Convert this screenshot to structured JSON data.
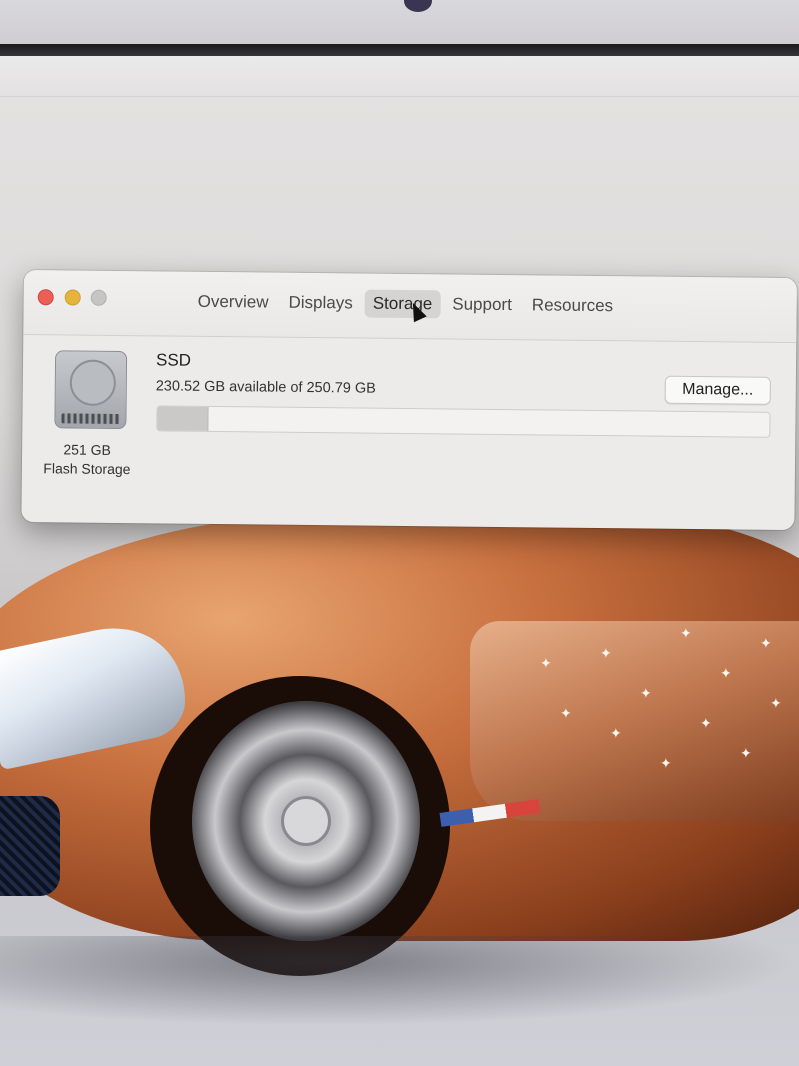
{
  "window": {
    "tabs": [
      {
        "label": "Overview",
        "active": false
      },
      {
        "label": "Displays",
        "active": false
      },
      {
        "label": "Storage",
        "active": true
      },
      {
        "label": "Support",
        "active": false
      },
      {
        "label": "Resources",
        "active": false
      }
    ]
  },
  "storage": {
    "drive_name": "SSD",
    "available_text": "230.52 GB available of 250.79 GB",
    "manage_label": "Manage...",
    "capacity_label": "251 GB",
    "type_label": "Flash Storage",
    "used_fraction": 0.081
  },
  "colors": {
    "close": "#ec5f57",
    "minimize": "#e6b33c",
    "zoom": "#c7c5c3"
  },
  "icons": {
    "disk": "hard-drive-icon",
    "pointer": "cursor-icon"
  }
}
